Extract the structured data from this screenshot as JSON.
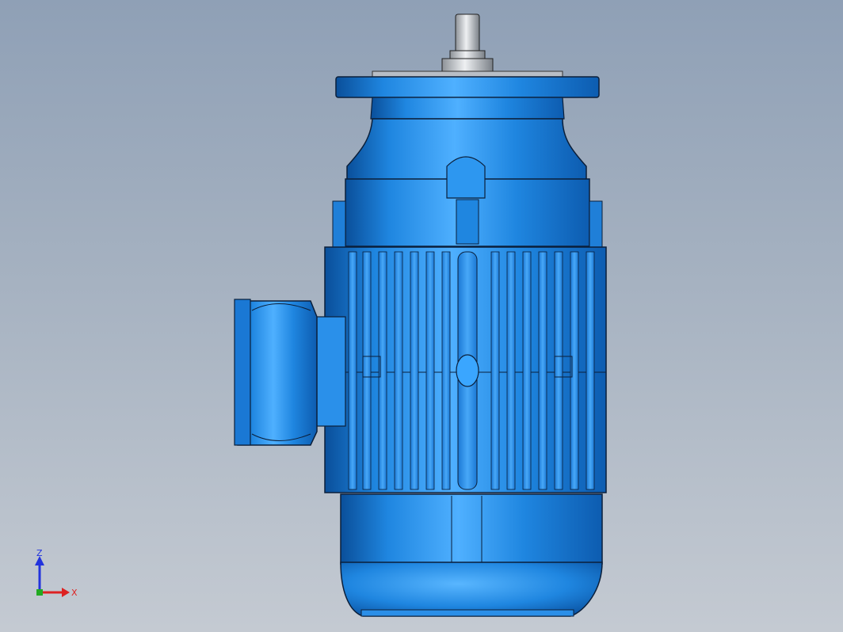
{
  "viewport": {
    "background_top": "#8fa0b6",
    "background_bottom": "#c4cad2"
  },
  "model": {
    "body_color": "#1f86e0",
    "body_dark": "#0a4f9a",
    "body_light": "#5cb8ff",
    "outline_color": "#0b1f3a",
    "shaft_color": "#c9ccd1"
  },
  "triad": {
    "z_label": "Z",
    "x_label": "X",
    "z_color": "#2233dd",
    "x_color": "#dd2222",
    "y_color": "#22aa22"
  }
}
